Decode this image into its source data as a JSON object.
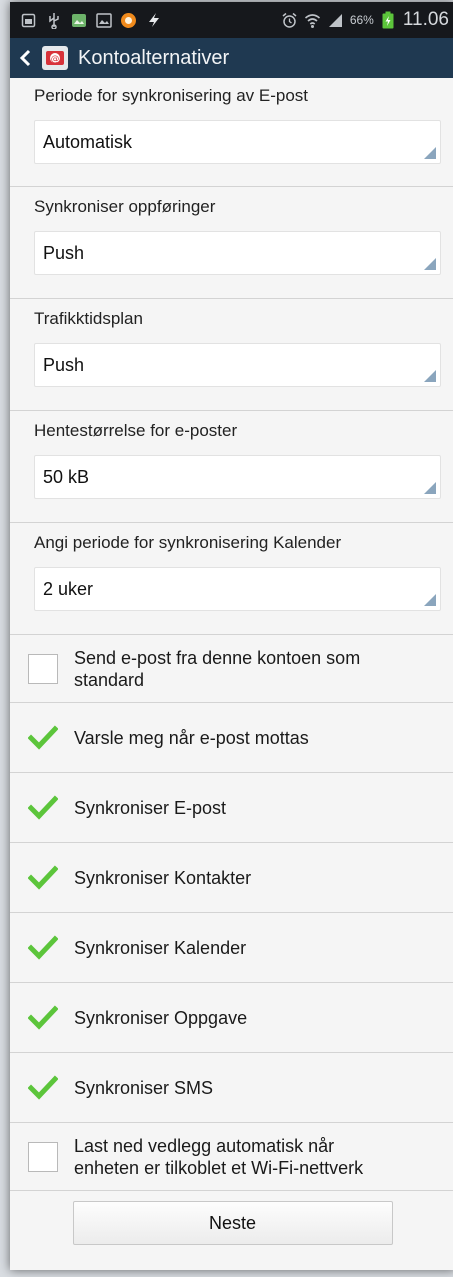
{
  "status_bar": {
    "battery_percent": "66%",
    "time": "11.06",
    "icons": [
      "screenshot-icon",
      "usb-icon",
      "image-icon",
      "gallery-icon",
      "app-orange-icon",
      "flash-icon",
      "alarm-icon",
      "wifi-icon",
      "signal-icon",
      "battery-charging-icon"
    ]
  },
  "action_bar": {
    "title": "Kontoalternativer",
    "back_icon": "chevron-left-icon",
    "app_icon": "email-app-icon"
  },
  "settings": [
    {
      "label": "Periode for synkronisering av E-post",
      "value": "Automatisk"
    },
    {
      "label": "Synkroniser oppføringer",
      "value": "Push"
    },
    {
      "label": "Trafikktidsplan",
      "value": "Push"
    },
    {
      "label": "Hentestørrelse for e-poster",
      "value": "50 kB"
    },
    {
      "label": "Angi periode for synkronisering Kalender",
      "value": "2 uker"
    }
  ],
  "checkboxes": [
    {
      "label_line1": "Send e-post fra denne kontoen som",
      "label_line2": "standard",
      "checked": false
    },
    {
      "label": "Varsle meg når e-post mottas",
      "checked": true
    },
    {
      "label": "Synkroniser E-post",
      "checked": true
    },
    {
      "label": "Synkroniser Kontakter",
      "checked": true
    },
    {
      "label": "Synkroniser Kalender",
      "checked": true
    },
    {
      "label": "Synkroniser Oppgave",
      "checked": true
    },
    {
      "label": "Synkroniser SMS",
      "checked": true
    },
    {
      "label_line1": "Last ned vedlegg automatisk når",
      "label_line2": "enheten er tilkoblet et Wi-Fi-nettverk",
      "checked": false
    }
  ],
  "footer": {
    "next_label": "Neste"
  },
  "colors": {
    "status_bar": "#16181c",
    "action_bar": "#1f3951",
    "check_green": "#5cc53b",
    "background": "#f5f5f5"
  }
}
